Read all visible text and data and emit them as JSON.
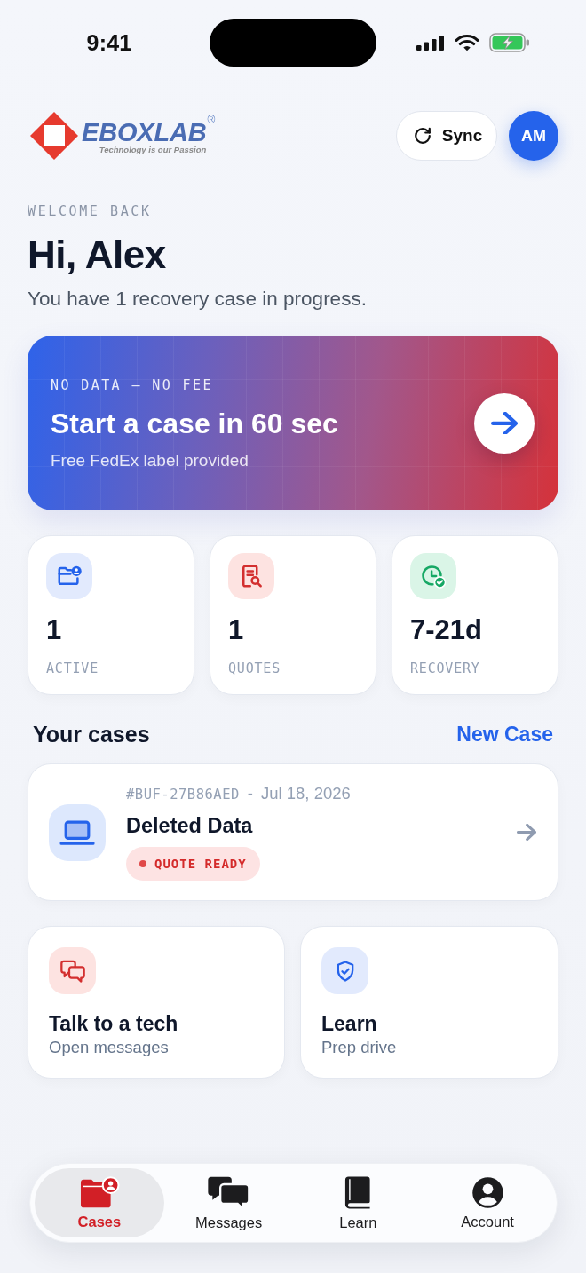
{
  "status_bar": {
    "time": "9:41"
  },
  "header": {
    "logo": {
      "wordmark": "EBOXLAB",
      "mark": "®",
      "tagline": "Technology is our Passion"
    },
    "sync_button": "Sync",
    "avatar": "AM"
  },
  "greeting": {
    "eyebrow": "WELCOME BACK",
    "title": "Hi, Alex",
    "subtitle": "You have 1 recovery case in progress."
  },
  "hero": {
    "eyebrow": "NO DATA – NO FEE",
    "title": "Start a case in 60 sec",
    "subtitle": "Free FedEx label provided"
  },
  "stats": [
    {
      "kind": "active",
      "value": "1",
      "label": "ACTIVE"
    },
    {
      "kind": "quotes",
      "value": "1",
      "label": "QUOTES"
    },
    {
      "kind": "recovery",
      "value": "7-21d",
      "label": "RECOVERY"
    }
  ],
  "cases_section": {
    "title": "Your cases",
    "action": "New Case"
  },
  "cases": [
    {
      "kind": "laptop",
      "case_id": "#BUF-27B86AED",
      "separator": "-",
      "date": "Jul 18, 2026",
      "title": "Deleted Data",
      "status": {
        "kind": "quote_ready",
        "label": "QUOTE READY"
      }
    }
  ],
  "actions": [
    {
      "kind": "messages",
      "title": "Talk to a tech",
      "subtitle": "Open messages"
    },
    {
      "kind": "learn",
      "title": "Learn",
      "subtitle": "Prep drive"
    }
  ],
  "tab_bar": [
    {
      "kind": "cases",
      "label": "Cases",
      "selected": true
    },
    {
      "kind": "messages",
      "label": "Messages",
      "selected": false
    },
    {
      "kind": "learn",
      "label": "Learn",
      "selected": false
    },
    {
      "kind": "account",
      "label": "Account",
      "selected": false
    }
  ]
}
